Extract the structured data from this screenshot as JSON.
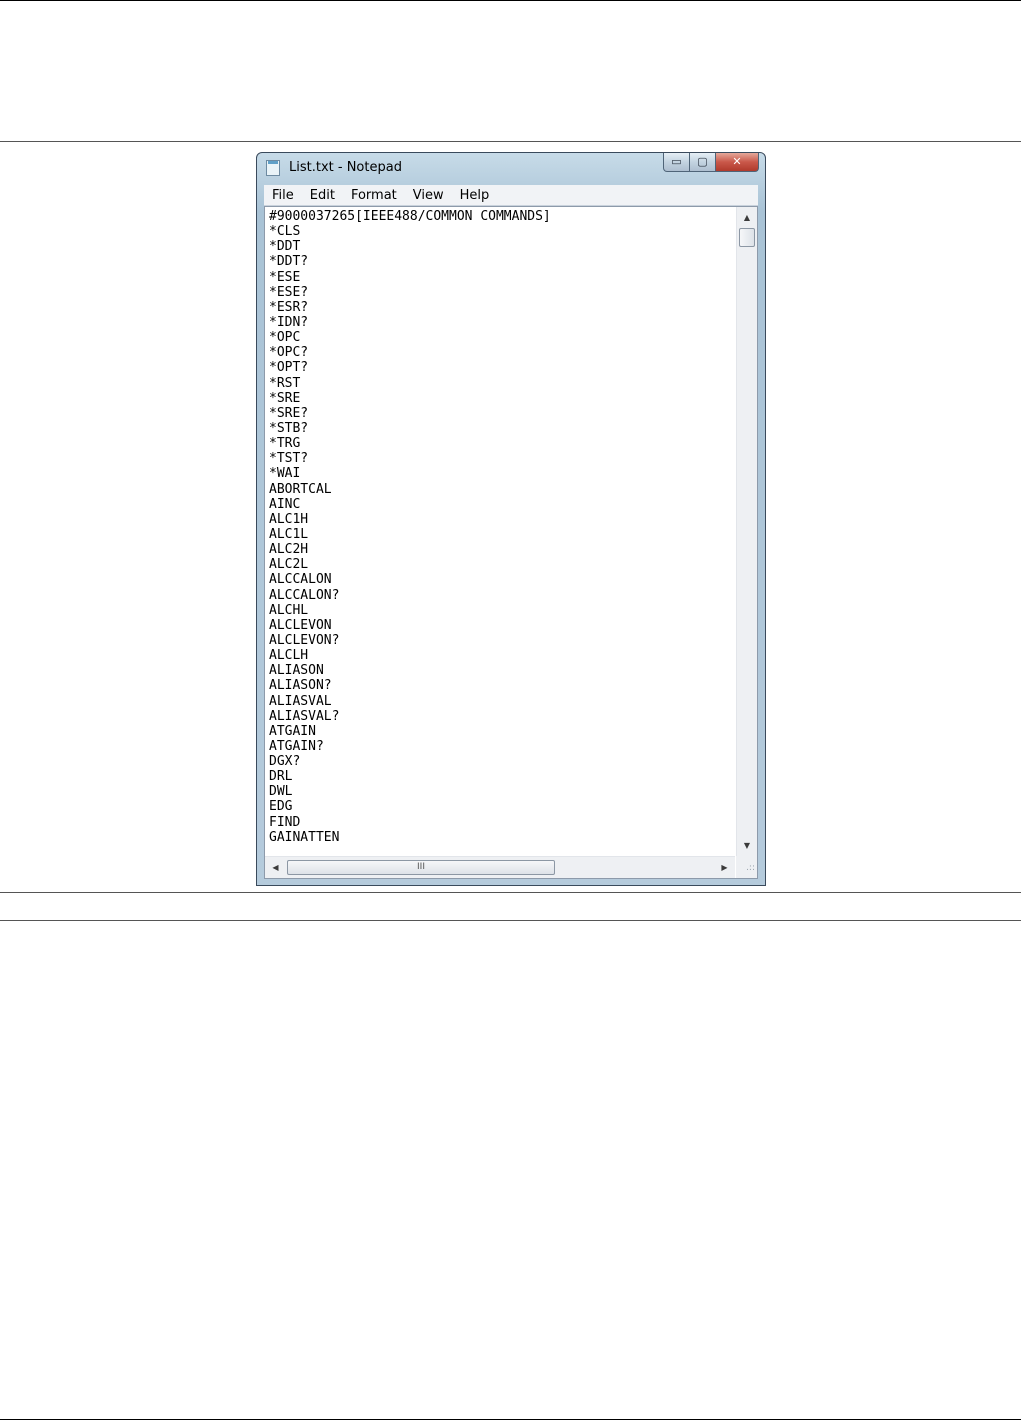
{
  "window": {
    "title": "List.txt - Notepad",
    "buttons": {
      "minimize": "▭",
      "maximize": "▢",
      "close": "✕"
    }
  },
  "menu": {
    "items": [
      {
        "label": "File"
      },
      {
        "label": "Edit"
      },
      {
        "label": "Format"
      },
      {
        "label": "View"
      },
      {
        "label": "Help"
      }
    ]
  },
  "document": {
    "lines": [
      "#9000037265[IEEE488/COMMON COMMANDS]",
      "*CLS",
      "*DDT",
      "*DDT?",
      "*ESE",
      "*ESE?",
      "*ESR?",
      "*IDN?",
      "*OPC",
      "*OPC?",
      "*OPT?",
      "*RST",
      "*SRE",
      "*SRE?",
      "*STB?",
      "*TRG",
      "*TST?",
      "*WAI",
      "ABORTCAL",
      "AINC",
      "ALC1H",
      "ALC1L",
      "ALC2H",
      "ALC2L",
      "ALCCALON",
      "ALCCALON?",
      "ALCHL",
      "ALCLEVON",
      "ALCLEVON?",
      "ALCLH",
      "ALIASON",
      "ALIASON?",
      "ALIASVAL",
      "ALIASVAL?",
      "ATGAIN",
      "ATGAIN?",
      "DGX?",
      "DRL",
      "DWL",
      "EDG",
      "FIND",
      "GAINATTEN"
    ]
  },
  "scrollbars": {
    "up_arrow": "▲",
    "down_arrow": "▼",
    "left_arrow": "◀",
    "right_arrow": "▶",
    "h_thumb_grip": "III",
    "size_grip": ".::"
  }
}
